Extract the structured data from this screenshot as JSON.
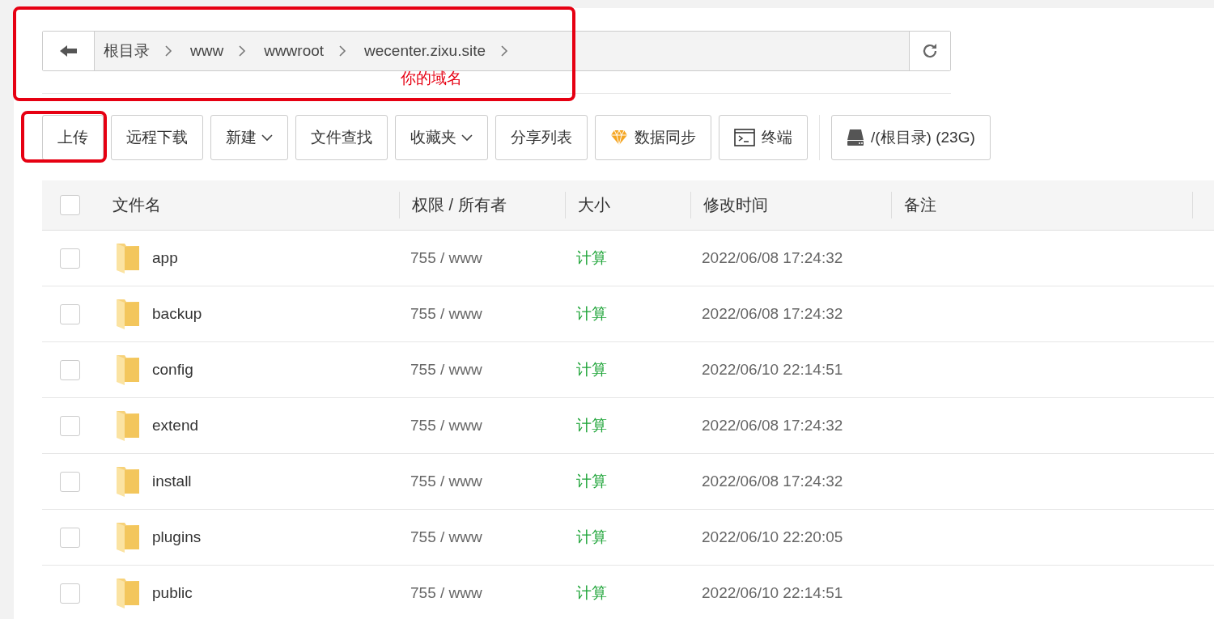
{
  "breadcrumb": {
    "segments": [
      "根目录",
      "www",
      "wwwroot",
      "wecenter.zixu.site"
    ]
  },
  "annotation": {
    "text": "你的域名"
  },
  "toolbar": [
    {
      "label": "上传",
      "kind": "plain",
      "highlighted": true
    },
    {
      "label": "远程下载",
      "kind": "plain",
      "highlighted": false
    },
    {
      "label": "新建",
      "kind": "dropdown",
      "highlighted": false
    },
    {
      "label": "文件查找",
      "kind": "plain",
      "highlighted": false
    },
    {
      "label": "收藏夹",
      "kind": "dropdown",
      "highlighted": false
    },
    {
      "label": "分享列表",
      "kind": "plain",
      "highlighted": false
    },
    {
      "label": "数据同步",
      "kind": "sync",
      "highlighted": false
    },
    {
      "label": "终端",
      "kind": "terminal",
      "highlighted": false
    },
    {
      "label": "/(根目录) (23G)",
      "kind": "disk",
      "highlighted": false
    }
  ],
  "table": {
    "all_checked": false,
    "columns": [
      "文件名",
      "权限 / 所有者",
      "大小",
      "修改时间",
      "备注"
    ],
    "rows": [
      {
        "name": "app",
        "permission": "755 / www",
        "size": "计算",
        "modified": "2022/06/08 17:24:32",
        "checked": false
      },
      {
        "name": "backup",
        "permission": "755 / www",
        "size": "计算",
        "modified": "2022/06/08 17:24:32",
        "checked": false
      },
      {
        "name": "config",
        "permission": "755 / www",
        "size": "计算",
        "modified": "2022/06/10 22:14:51",
        "checked": false
      },
      {
        "name": "extend",
        "permission": "755 / www",
        "size": "计算",
        "modified": "2022/06/08 17:24:32",
        "checked": false
      },
      {
        "name": "install",
        "permission": "755 / www",
        "size": "计算",
        "modified": "2022/06/08 17:24:32",
        "checked": false
      },
      {
        "name": "plugins",
        "permission": "755 / www",
        "size": "计算",
        "modified": "2022/06/10 22:20:05",
        "checked": false
      },
      {
        "name": "public",
        "permission": "755 / www",
        "size": "计算",
        "modified": "2022/06/10 22:14:51",
        "checked": false
      }
    ]
  }
}
